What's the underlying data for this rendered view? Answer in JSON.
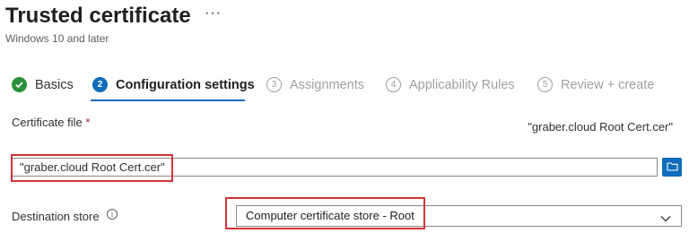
{
  "header": {
    "title": "Trusted certificate",
    "more_label": "···",
    "subtitle": "Windows 10 and later"
  },
  "steps": [
    {
      "number": "",
      "label": "Basics",
      "state": "done"
    },
    {
      "number": "2",
      "label": "Configuration settings",
      "state": "active"
    },
    {
      "number": "3",
      "label": "Assignments",
      "state": "todo"
    },
    {
      "number": "4",
      "label": "Applicability Rules",
      "state": "todo"
    },
    {
      "number": "5",
      "label": "Review + create",
      "state": "todo"
    }
  ],
  "form": {
    "certificate_file": {
      "label": "Certificate file",
      "required_marker": "*",
      "file_name": "\"graber.cloud Root Cert.cer\"",
      "input_value": "\"graber.cloud Root Cert.cer\""
    },
    "destination_store": {
      "label": "Destination store",
      "info_glyph": "i",
      "selected": "Computer certificate store - Root"
    }
  },
  "colors": {
    "accent": "#0f6cbd",
    "success": "#2a8f3a",
    "highlight": "#d13438"
  }
}
